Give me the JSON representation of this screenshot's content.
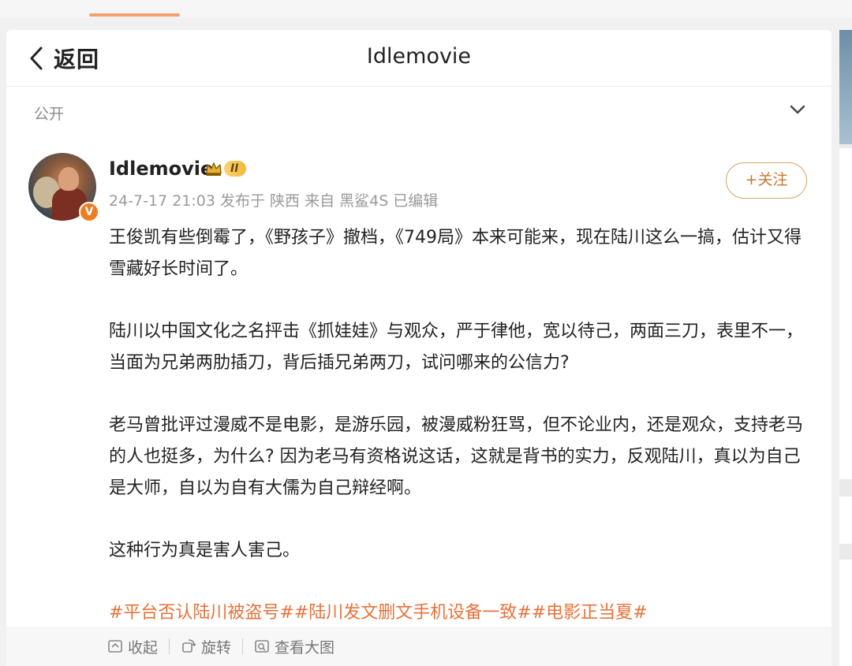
{
  "header": {
    "back_label": "返回",
    "title": "Idlemovie"
  },
  "visibility": {
    "label": "公开"
  },
  "post": {
    "username": "Idlemovie",
    "level": "II",
    "verified_badge": "V",
    "meta": "24-7-17 21:03  发布于 陕西  来自 黑鲨4S 已编辑",
    "follow_label": "+关注",
    "paragraphs": [
      "王俊凯有些倒霉了，《野孩子》撤档，《749局》本来可能来，现在陆川这么一搞，估计又得雪藏好长时间了。",
      "陆川以中国文化之名抨击《抓娃娃》与观众，严于律他，宽以待己，两面三刀，表里不一，当面为兄弟两肋插刀，背后插兄弟两刀，试问哪来的公信力?",
      "老马曾批评过漫威不是电影，是游乐园，被漫威粉狂骂，但不论业内，还是观众，支持老马的人也挺多，为什么? 因为老马有资格说这话，这就是背书的实力，反观陆川，真以为自己是大师，自以为自有大儒为自己辩经啊。",
      "这种行为真是害人害己。"
    ],
    "tags": "#平台否认陆川被盗号##陆川发文删文手机设备一致##电影正当夏#"
  },
  "footer": {
    "collapse_label": "收起",
    "rotate_label": "旋转",
    "view_large_label": "查看大图"
  },
  "colors": {
    "accent_orange": "#e8713a",
    "follow_border": "#d9a36a",
    "verified_orange": "#f07c1f"
  },
  "icons": [
    "back-chevron-icon",
    "chevron-down-icon",
    "crown-icon",
    "collapse-icon",
    "rotate-icon",
    "view-large-image-icon"
  ]
}
